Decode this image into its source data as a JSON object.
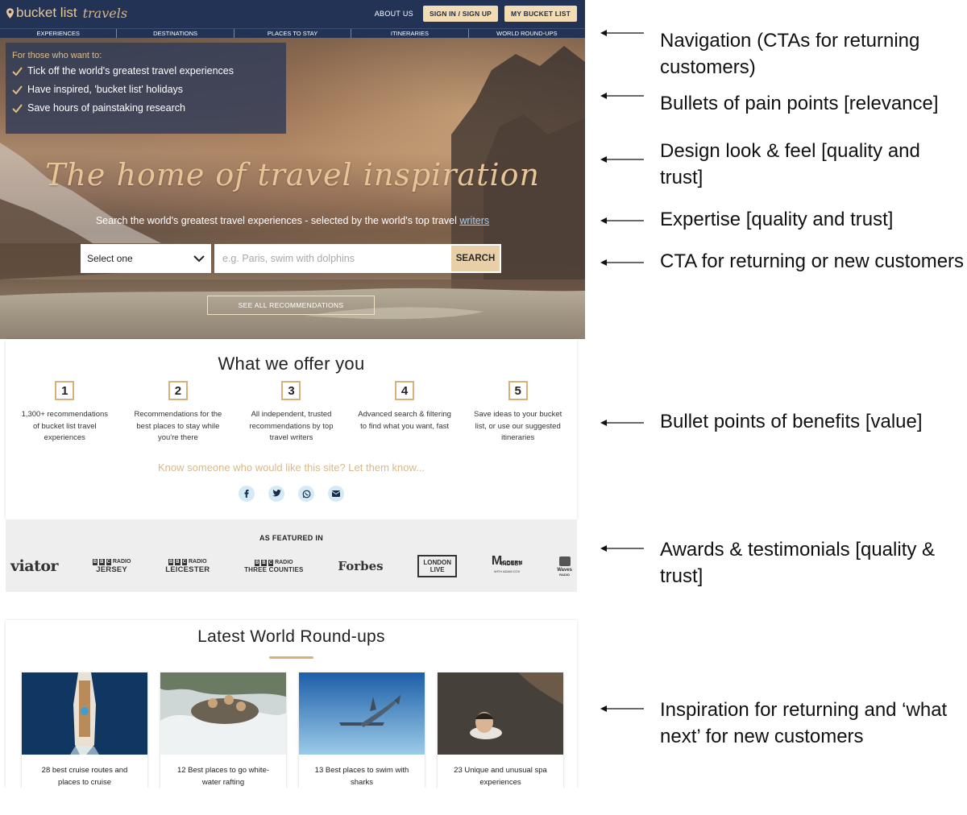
{
  "site": {
    "logo_main": "bucket list",
    "logo_script": "travels",
    "header": {
      "about": "ABOUT US",
      "signin": "SIGN IN / SIGN UP",
      "mylist": "MY BUCKET LIST"
    },
    "nav": [
      "EXPERIENCES",
      "DESTINATIONS",
      "PLACES TO STAY",
      "ITINERARIES",
      "WORLD ROUND-UPS"
    ],
    "hero": {
      "intro": "For those who want to:",
      "bullets": [
        "Tick off the world's greatest travel experiences",
        "Have inspired, 'bucket list' holidays",
        "Save hours of painstaking research"
      ],
      "title": "The home of travel inspiration",
      "subtitle": "Search the world's greatest travel experiences - selected by the world's top travel",
      "subtitle_link": "writers",
      "select_label": "Select one",
      "search_placeholder": "e.g. Paris, swim with dolphins",
      "search_button": "SEARCH",
      "see_all": "SEE ALL RECOMMENDATIONS"
    },
    "offer": {
      "title": "What we offer you",
      "items": [
        {
          "num": "1",
          "text": "1,300+ recommendations of bucket list travel experiences"
        },
        {
          "num": "2",
          "text": "Recommendations for the best places to stay while you're there"
        },
        {
          "num": "3",
          "text": "All independent, trusted recommendations by top travel writers"
        },
        {
          "num": "4",
          "text": "Advanced search & filtering to find what you want, fast"
        },
        {
          "num": "5",
          "text": "Save ideas to your bucket list, or use our suggested itineraries"
        }
      ],
      "share_prompt": "Know someone who would like this site? Let them know...",
      "share_icons": [
        "facebook-icon",
        "twitter-icon",
        "whatsapp-icon",
        "email-icon"
      ]
    },
    "featured": {
      "title": "AS FEATURED IN",
      "logos": {
        "viator": "viator",
        "bbc_radio": "RADIO",
        "jersey": "JERSEY",
        "leicester": "LEICESTER",
        "three_counties": "THREE COUNTIES",
        "forbes": "Forbes",
        "london_live_1": "LONDON",
        "london_live_2": "LIVE",
        "modern": "ODERN",
        "mindset": "INDSET",
        "adam_cox": "WITH ADAM COX",
        "waves": "Waves",
        "waves_sub": "RADIO"
      }
    },
    "roundups": {
      "title": "Latest World Round-ups",
      "cards": [
        {
          "text": "28 best cruise routes and places to cruise"
        },
        {
          "text": "12 Best places to go white-water rafting"
        },
        {
          "text": "13 Best places to swim with sharks"
        },
        {
          "text": "23 Unique and unusual spa experiences"
        }
      ]
    }
  },
  "annotations": [
    "Navigation (CTAs for returning customers)",
    "Bullets of pain points [relevance]",
    "Design look & feel [quality and trust]",
    "Expertise [quality and trust]",
    "CTA for returning or new customers",
    "Bullet points of benefits [value]",
    "Awards & testimonials [quality & trust]",
    "Inspiration for returning and ‘what next’ for new customers"
  ],
  "colors": {
    "navy": "#223356",
    "gold": "#d7b17c",
    "gold_button": "#f3dcb4"
  }
}
